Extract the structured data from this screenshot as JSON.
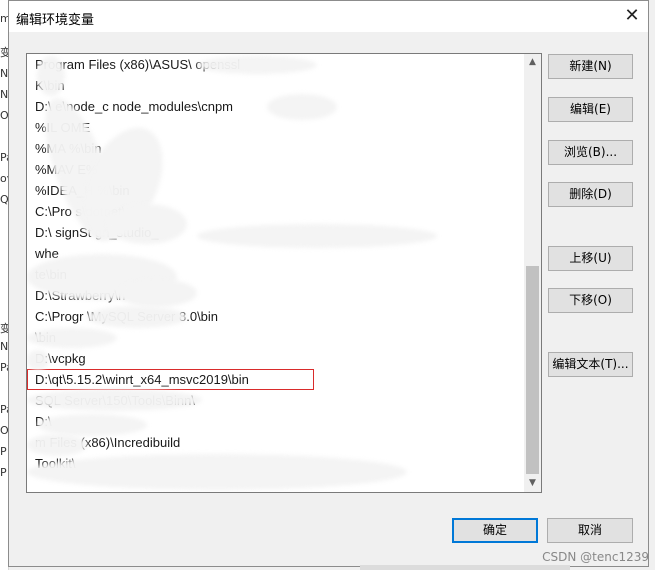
{
  "window": {
    "title": "编辑环境变量",
    "close_icon": "close-icon",
    "close_glyph": "✕"
  },
  "paths": [
    "Program Files (x86)\\ASUS\\                              openssl",
    "  K\\bin",
    "D:\\          e\\node_c       node_modules\\cnpm",
    "%IL       OME",
    "%MA              %\\bin",
    "%MAV              E%",
    "%IDEA_H          %\\bin",
    "C:\\Pro               s\\dotnet\\",
    "D:\\                  signSt                  gn_studio_",
    "          whe",
    "                          te\\bin",
    "D:\\Strawberry\\n",
    "C:\\Progr                       \\MySQL Server 8.0\\bin",
    "                    \\bin",
    "D:\\vcpkg",
    "D:\\qt\\5.15.2\\winrt_x64_msvc2019\\bin",
    "                                   SQL Server\\150\\Tools\\Binn\\",
    "D:\\",
    "           m Files (x86)\\Incredibuild",
    "                                                                   Toolkit\\",
    ""
  ],
  "buttons": {
    "new": "新建(N)",
    "edit": "编辑(E)",
    "browse": "浏览(B)...",
    "delete": "删除(D)",
    "move_up": "上移(U)",
    "move_down": "下移(O)",
    "edit_text": "编辑文本(T)...",
    "ok": "确定",
    "cancel": "取消"
  },
  "scrollbar": {
    "up_glyph": "▲",
    "down_glyph": "▼"
  },
  "background_fragments": [
    "m",
    "变",
    "N",
    "N",
    "O",
    "Pa",
    "ov",
    "Q",
    "变",
    "N",
    "Pa",
    "Pa",
    "O",
    "P",
    "P"
  ],
  "watermark": "CSDN @tenc1239"
}
